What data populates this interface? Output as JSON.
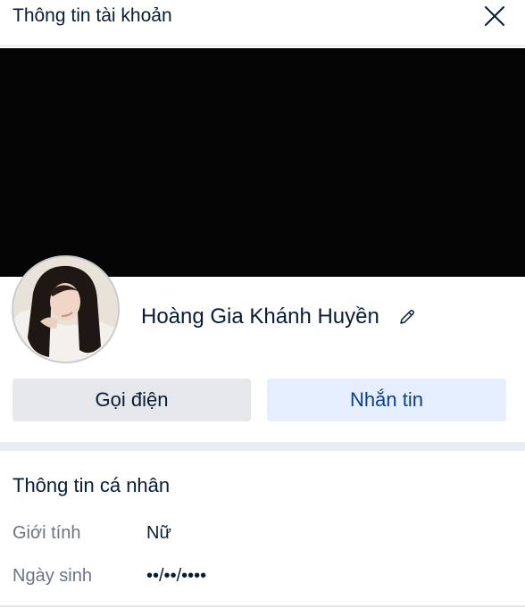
{
  "header": {
    "title": "Thông tin tài khoản",
    "close_icon": "close-icon"
  },
  "profile": {
    "name": "Hoàng Gia Khánh Huyền",
    "edit_icon": "pencil-icon"
  },
  "actions": {
    "call_label": "Gọi điện",
    "message_label": "Nhắn tin"
  },
  "personal_info": {
    "title": "Thông tin cá nhân",
    "gender_label": "Giới tính",
    "gender_value": "Nữ",
    "birthday_label": "Ngày sinh",
    "birthday_value": "••/••/••••"
  },
  "colors": {
    "primary_text": "#081c36",
    "secondary_text": "#6b7480",
    "message_button_bg": "#e5efff",
    "message_button_text": "#0b3f8e",
    "call_button_bg": "#e5e7eb",
    "cover_bg": "#050505"
  }
}
